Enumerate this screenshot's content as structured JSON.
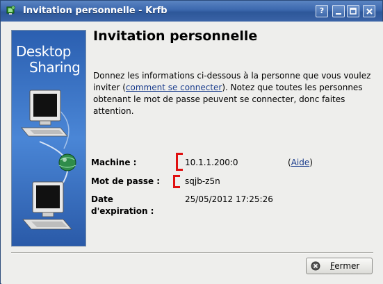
{
  "window": {
    "title": "Invitation personnelle - Krfb",
    "buttons": {
      "help": "?",
      "minimize": "minimize",
      "maximize": "maximize",
      "close": "close"
    },
    "titlebar_color": "#3b67ad"
  },
  "side_image": {
    "line1": "Desktop",
    "line2": "Sharing"
  },
  "heading": "Invitation personnelle",
  "intro": {
    "before_link": "Donnez les informations ci-dessous à la personne que vous voulez inviter (",
    "link_text": "comment se connecter",
    "after_link": "). Notez que toutes les personnes obtenant le mot de passe peuvent se connecter, donc faites attention."
  },
  "fields": {
    "machine_label": "Machine :",
    "machine_value": "10.1.1.200:0",
    "help_open": "(",
    "help_link": "Aide",
    "help_close": ")",
    "password_label": "Mot de passe :",
    "password_value": "sqjb-z5n",
    "expiration_label_line1": "Date",
    "expiration_label_line2": "d'expiration :",
    "expiration_value": "25/05/2012 17:25:26"
  },
  "footer": {
    "close_button_mnemonic": "F",
    "close_button_rest": "ermer",
    "close_icon": "close-circle-icon"
  },
  "annotation_color": "#e01010"
}
